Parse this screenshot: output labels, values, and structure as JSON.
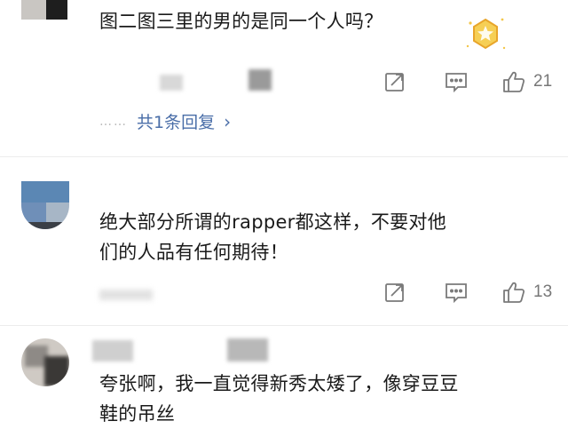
{
  "comments": [
    {
      "text": "图二图三里的男的是同一个人吗？",
      "likes": "21",
      "replies_label": "共1条回复",
      "replies_prefix": "……",
      "chevron": "›",
      "badge_icon": "golden-medal-icon"
    },
    {
      "text_line1": "绝大部分所谓的rapper都这样，不要对他",
      "text_line2": "们的人品有任何期待！",
      "likes": "13"
    },
    {
      "text_line1": "夸张啊，我一直觉得新秀太矮了，像穿豆豆",
      "text_line2": "鞋的吊丝"
    }
  ],
  "icons": {
    "share": "share-icon",
    "comment": "comment-icon",
    "like": "thumbs-up-icon"
  },
  "colors": {
    "link": "#4a6ea8",
    "count": "#777777",
    "icon": "#7a7a7a"
  }
}
